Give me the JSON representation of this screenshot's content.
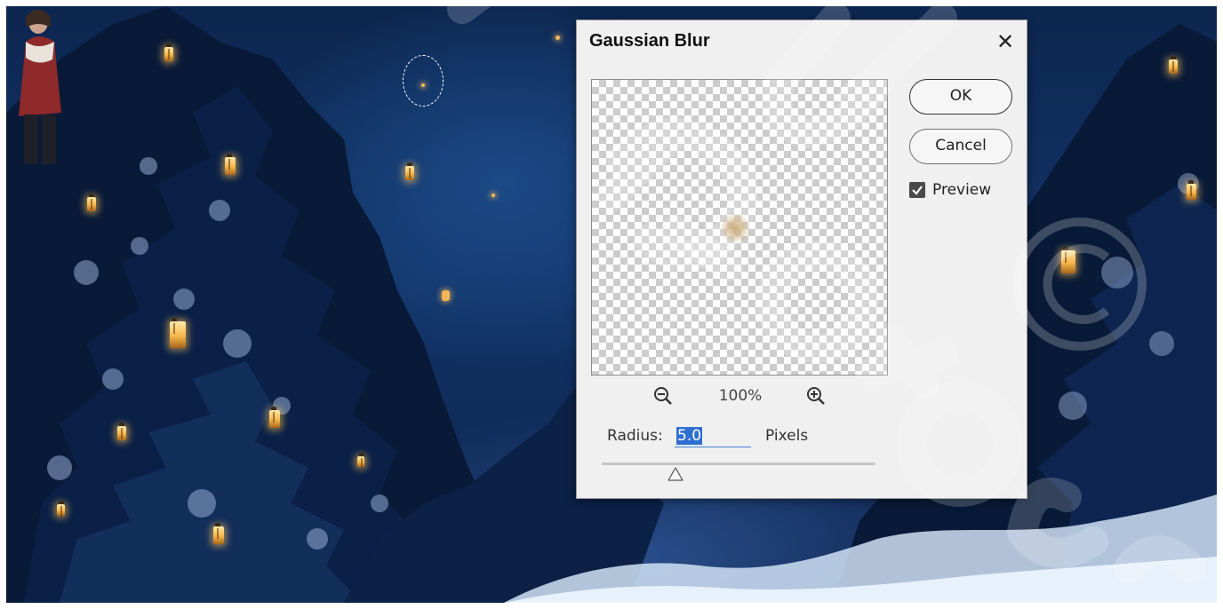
{
  "dialog": {
    "title": "Gaussian Blur",
    "close_icon": "close-icon",
    "ok_label": "OK",
    "cancel_label": "Cancel",
    "preview_label": "Preview",
    "preview_checked": true,
    "zoom_level": "100%",
    "zoom_out_icon": "zoom-out-icon",
    "zoom_in_icon": "zoom-in-icon",
    "radius_label": "Radius:",
    "radius_value": "5.0",
    "radius_units": "Pixels"
  },
  "canvas": {
    "selection": "elliptical-marquee"
  },
  "watermark": {
    "text": "Copyright Photoshop ©"
  },
  "colors": {
    "accent": "#2f6fd1",
    "dialog_bg": "#f0f0f0",
    "scene_sky": "#123468"
  }
}
